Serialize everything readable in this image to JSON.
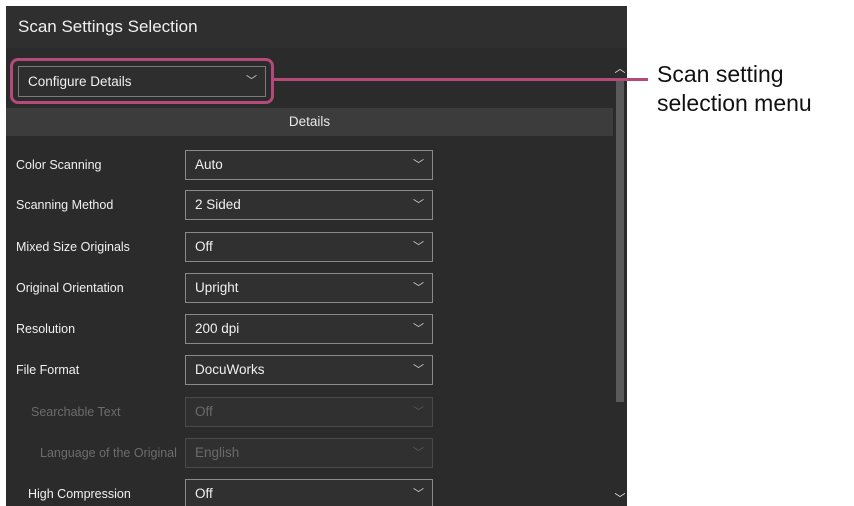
{
  "window": {
    "title": "Scan Settings Selection"
  },
  "config_menu": {
    "value": "Configure Details"
  },
  "section": {
    "header": "Details"
  },
  "settings": [
    {
      "label": "Color Scanning",
      "value": "Auto",
      "enabled": true
    },
    {
      "label": "Scanning Method",
      "value": "2 Sided",
      "enabled": true
    },
    {
      "label": "Mixed Size Originals",
      "value": "Off",
      "enabled": true
    },
    {
      "label": "Original Orientation",
      "value": "Upright",
      "enabled": true
    },
    {
      "label": "Resolution",
      "value": "200 dpi",
      "enabled": true
    },
    {
      "label": "File Format",
      "value": "DocuWorks",
      "enabled": true
    },
    {
      "label": "Searchable Text",
      "value": "Off",
      "enabled": false
    },
    {
      "label": "Language of the Original",
      "value": "English",
      "enabled": false
    },
    {
      "label": "High Compression",
      "value": "Off",
      "enabled": true
    }
  ],
  "callout": {
    "line1": "Scan setting",
    "line2": "selection menu"
  },
  "colors": {
    "panel_bg": "#2b2b2b",
    "highlight": "#b34a78",
    "disabled_text": "#6c6c6c"
  }
}
